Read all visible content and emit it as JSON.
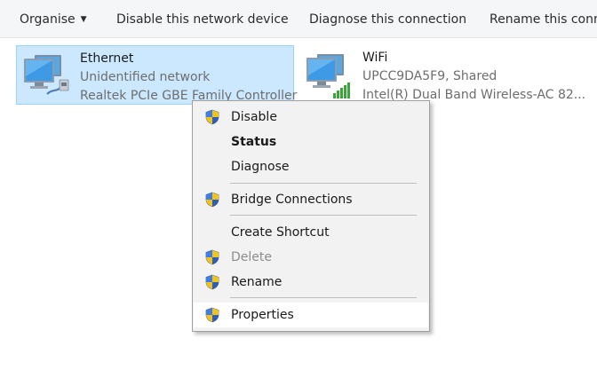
{
  "toolbar": {
    "organise": "Organise",
    "disable": "Disable this network device",
    "diagnose": "Diagnose this connection",
    "rename": "Rename this connection"
  },
  "adapters": [
    {
      "name": "Ethernet",
      "status": "Unidentified network",
      "device": "Realtek PCIe GBE Family Controller",
      "icon": "ethernet-adapter-icon",
      "selected": true
    },
    {
      "name": "WiFi",
      "status": "UPCC9DA5F9, Shared",
      "device": "Intel(R) Dual Band Wireless-AC 82...",
      "icon": "wifi-adapter-icon",
      "selected": false
    }
  ],
  "context_menu": {
    "disable": "Disable",
    "status": "Status",
    "diagnose": "Diagnose",
    "bridge": "Bridge Connections",
    "create_shortcut": "Create Shortcut",
    "delete": "Delete",
    "rename": "Rename",
    "properties": "Properties",
    "shield_icon": "uac-shield-icon"
  },
  "colors": {
    "selection_bg": "#cce8ff",
    "selection_border": "#99d1ff",
    "menu_bg": "#f2f2f2",
    "toolbar_bg": "#f5f6f7"
  }
}
